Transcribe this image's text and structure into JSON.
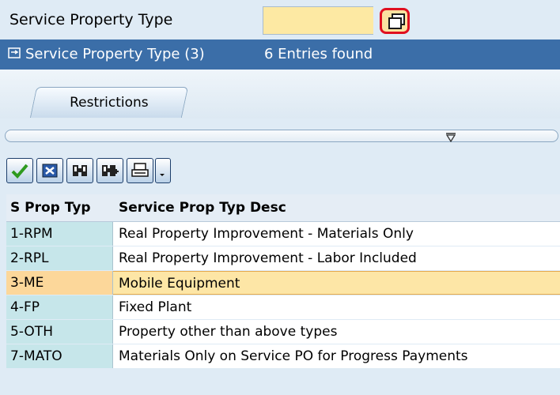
{
  "field": {
    "label": "Service Property Type",
    "value": ""
  },
  "popup": {
    "title": "Service Property Type (3)",
    "count": "6 Entries found"
  },
  "tabs": [
    {
      "label": "Restrictions"
    }
  ],
  "toolbar": {
    "buttons": [
      {
        "icon": "checkmark-icon"
      },
      {
        "icon": "cancel-icon"
      },
      {
        "icon": "find-icon"
      },
      {
        "icon": "find-next-icon"
      },
      {
        "icon": "print-icon"
      },
      {
        "icon": "dropdown-icon"
      }
    ]
  },
  "table": {
    "columns": [
      "S Prop Typ",
      "Service Prop Typ Desc"
    ],
    "rows": [
      {
        "key": "1-RPM",
        "desc": "Real Property Improvement - Materials Only"
      },
      {
        "key": "2-RPL",
        "desc": "Real Property Improvement - Labor Included"
      },
      {
        "key": "3-ME",
        "desc": "Mobile Equipment",
        "selected": true
      },
      {
        "key": "4-FP",
        "desc": "Fixed Plant"
      },
      {
        "key": "5-OTH",
        "desc": "Property other than above types"
      },
      {
        "key": "7-MATO",
        "desc": "Materials Only on Service PO for Progress Payments"
      }
    ]
  },
  "colors": {
    "titlebar": "#3b6ea8",
    "input": "#fde9a3",
    "highlight": "#e01020",
    "selected_row": "#fde6a6",
    "key_cell": "#c6e6ea"
  }
}
